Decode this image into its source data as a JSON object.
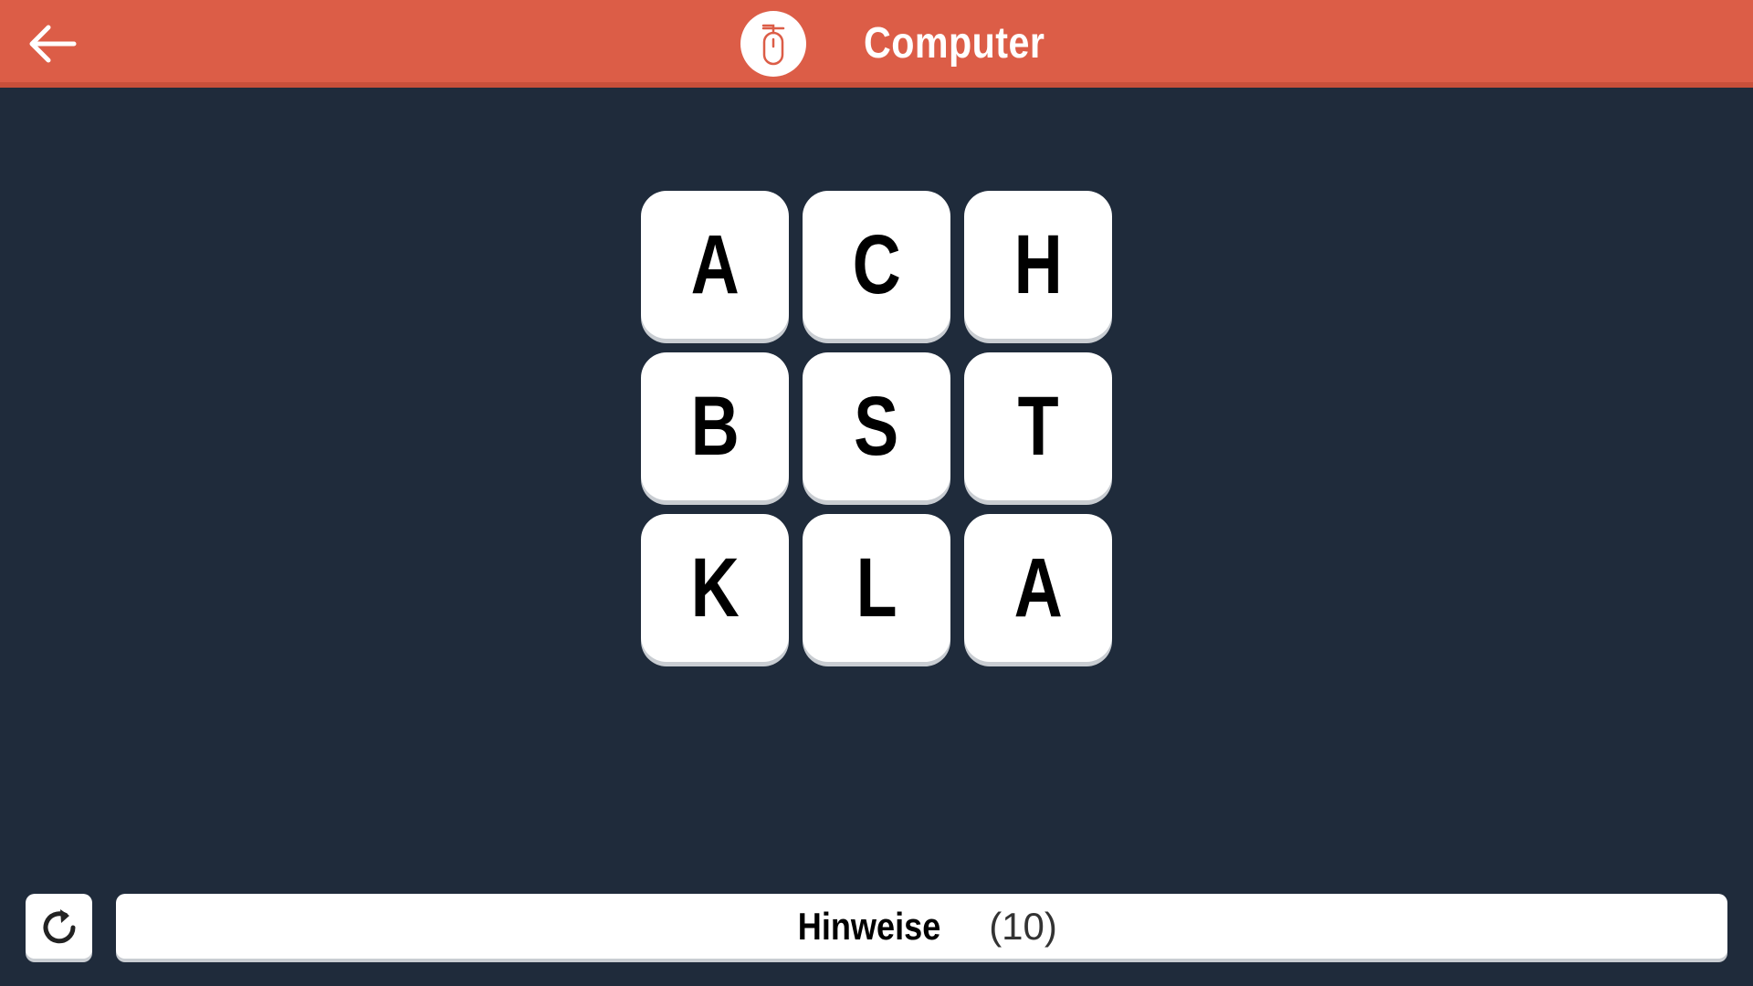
{
  "header": {
    "back_icon": "arrow-left-icon",
    "category_icon": "computer-mouse-icon",
    "title": "Computer"
  },
  "board": {
    "tiles": [
      {
        "letter": "A"
      },
      {
        "letter": "C"
      },
      {
        "letter": "H"
      },
      {
        "letter": "B"
      },
      {
        "letter": "S"
      },
      {
        "letter": "T"
      },
      {
        "letter": "K"
      },
      {
        "letter": "L"
      },
      {
        "letter": "A"
      }
    ]
  },
  "footer": {
    "refresh_icon": "refresh-icon",
    "hint_label": "Hinweise",
    "hint_count": "(10)"
  },
  "colors": {
    "header_bg": "#dc5d47",
    "page_bg": "#1f2b3b",
    "tile_bg": "#ffffff"
  }
}
